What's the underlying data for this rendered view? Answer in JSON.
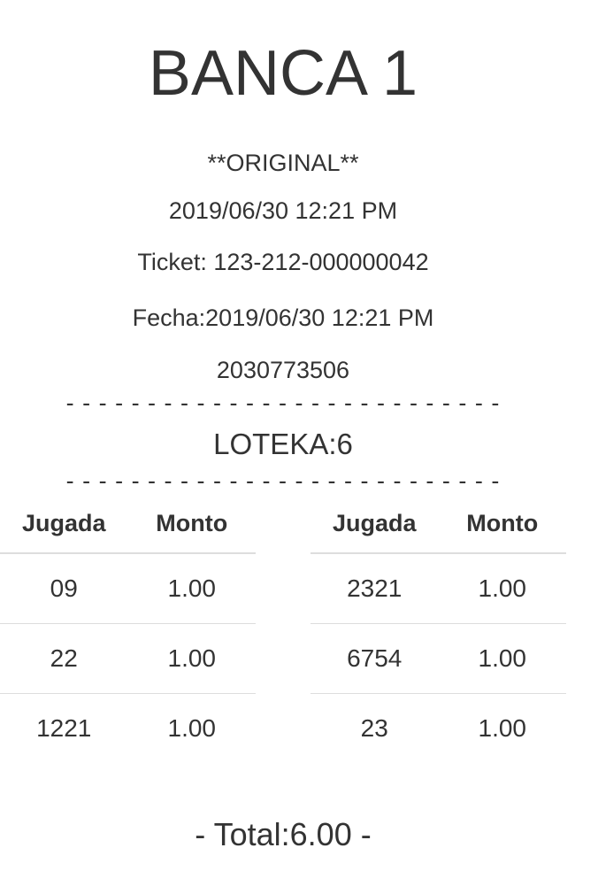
{
  "ticket": {
    "title": "BANCA 1",
    "copy_label": "**ORIGINAL**",
    "printed_datetime": "2019/06/30 12:21 PM",
    "ticket_number": "Ticket: 123-212-000000042",
    "date_line": "Fecha:2019/06/30 12:21 PM",
    "serial": "2030773506",
    "separator": "- - - - - - - - - - - - - - - - - - - - - - - - - - -",
    "lottery": "LOTEKA:6",
    "total": "- Total:6.00 -"
  },
  "plays_left": {
    "headers": [
      "Jugada",
      "Monto"
    ],
    "rows": [
      [
        "09",
        "1.00"
      ],
      [
        "22",
        "1.00"
      ],
      [
        "1221",
        "1.00"
      ]
    ]
  },
  "plays_right": {
    "headers": [
      "Jugada",
      "Monto"
    ],
    "rows": [
      [
        "2321",
        "1.00"
      ],
      [
        "6754",
        "1.00"
      ],
      [
        "23",
        "1.00"
      ]
    ]
  }
}
